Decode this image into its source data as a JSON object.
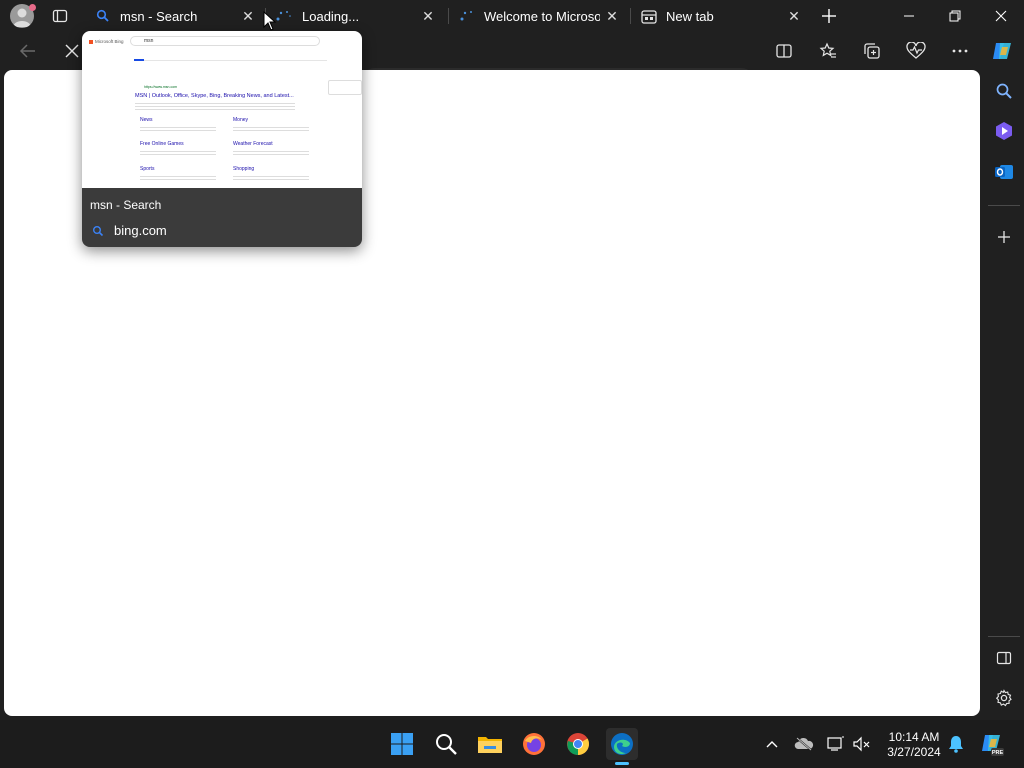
{
  "tabs": [
    {
      "title": "msn - Search",
      "icon": "search-icon"
    },
    {
      "title": "Loading...",
      "icon": "loading-spinner-icon"
    },
    {
      "title": "Welcome to Microsoft",
      "icon": "loading-spinner-icon"
    },
    {
      "title": "New tab",
      "icon": "new-tab-icon"
    }
  ],
  "preview": {
    "title": "msn - Search",
    "domain": "bing.com",
    "thumbnail": {
      "brand": "Microsoft Bing",
      "query": "msn",
      "result_title": "MSN | Outlook, Office, Skype, Bing, Breaking News, and Latest...",
      "result_url": "https://www.msn.com",
      "sitelinks": [
        "News",
        "Money",
        "Free Online Games",
        "Weather Forecast",
        "Sports",
        "Shopping"
      ]
    }
  },
  "clock": {
    "time": "10:14 AM",
    "date": "3/27/2024"
  },
  "colors": {
    "frame": "#202020",
    "taskbar": "#1c1c1c",
    "accent": "#4cc2ff",
    "page": "#ffffff"
  }
}
